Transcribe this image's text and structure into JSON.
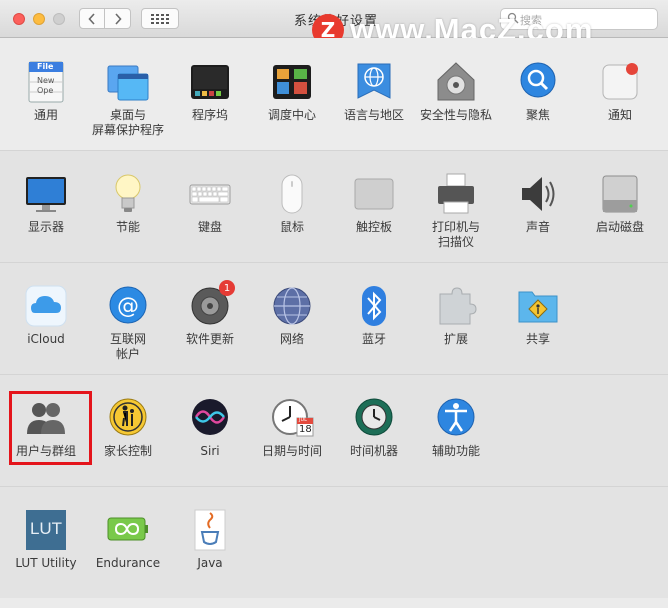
{
  "window": {
    "title": "系统偏好设置",
    "search_placeholder": "搜索"
  },
  "watermark": {
    "logo": "Z",
    "text": "www.MacZ.com"
  },
  "rows": [
    {
      "items": [
        {
          "label": "通用",
          "icon": "general-icon"
        },
        {
          "label": "桌面与\n屏幕保护程序",
          "icon": "desktop-screensaver-icon"
        },
        {
          "label": "程序坞",
          "icon": "dock-icon"
        },
        {
          "label": "调度中心",
          "icon": "mission-control-icon"
        },
        {
          "label": "语言与地区",
          "icon": "language-region-icon"
        },
        {
          "label": "安全性与隐私",
          "icon": "security-privacy-icon"
        },
        {
          "label": "聚焦",
          "icon": "spotlight-icon"
        },
        {
          "label": "通知",
          "icon": "notifications-icon"
        }
      ]
    },
    {
      "items": [
        {
          "label": "显示器",
          "icon": "displays-icon"
        },
        {
          "label": "节能",
          "icon": "energy-saver-icon"
        },
        {
          "label": "键盘",
          "icon": "keyboard-icon"
        },
        {
          "label": "鼠标",
          "icon": "mouse-icon"
        },
        {
          "label": "触控板",
          "icon": "trackpad-icon"
        },
        {
          "label": "打印机与\n扫描仪",
          "icon": "printers-scanners-icon"
        },
        {
          "label": "声音",
          "icon": "sound-icon"
        },
        {
          "label": "启动磁盘",
          "icon": "startup-disk-icon"
        }
      ]
    },
    {
      "items": [
        {
          "label": "iCloud",
          "icon": "icloud-icon"
        },
        {
          "label": "互联网\n帐户",
          "icon": "internet-accounts-icon"
        },
        {
          "label": "软件更新",
          "icon": "software-update-icon",
          "badge": "1"
        },
        {
          "label": "网络",
          "icon": "network-icon"
        },
        {
          "label": "蓝牙",
          "icon": "bluetooth-icon"
        },
        {
          "label": "扩展",
          "icon": "extensions-icon"
        },
        {
          "label": "共享",
          "icon": "sharing-icon"
        }
      ]
    },
    {
      "items": [
        {
          "label": "用户与群组",
          "icon": "users-groups-icon"
        },
        {
          "label": "家长控制",
          "icon": "parental-controls-icon"
        },
        {
          "label": "Siri",
          "icon": "siri-icon"
        },
        {
          "label": "日期与时间",
          "icon": "date-time-icon",
          "calendar": {
            "month": "JUL",
            "day": "18"
          }
        },
        {
          "label": "时间机器",
          "icon": "time-machine-icon"
        },
        {
          "label": "辅助功能",
          "icon": "accessibility-icon"
        }
      ]
    },
    {
      "items": [
        {
          "label": "LUT Utility",
          "icon": "lut-utility-icon",
          "icon_text": "LUT"
        },
        {
          "label": "Endurance",
          "icon": "endurance-icon"
        },
        {
          "label": "Java",
          "icon": "java-icon"
        }
      ]
    }
  ],
  "general_icon_text": [
    "File",
    "New",
    "Ope"
  ],
  "selected": "用户与群组"
}
